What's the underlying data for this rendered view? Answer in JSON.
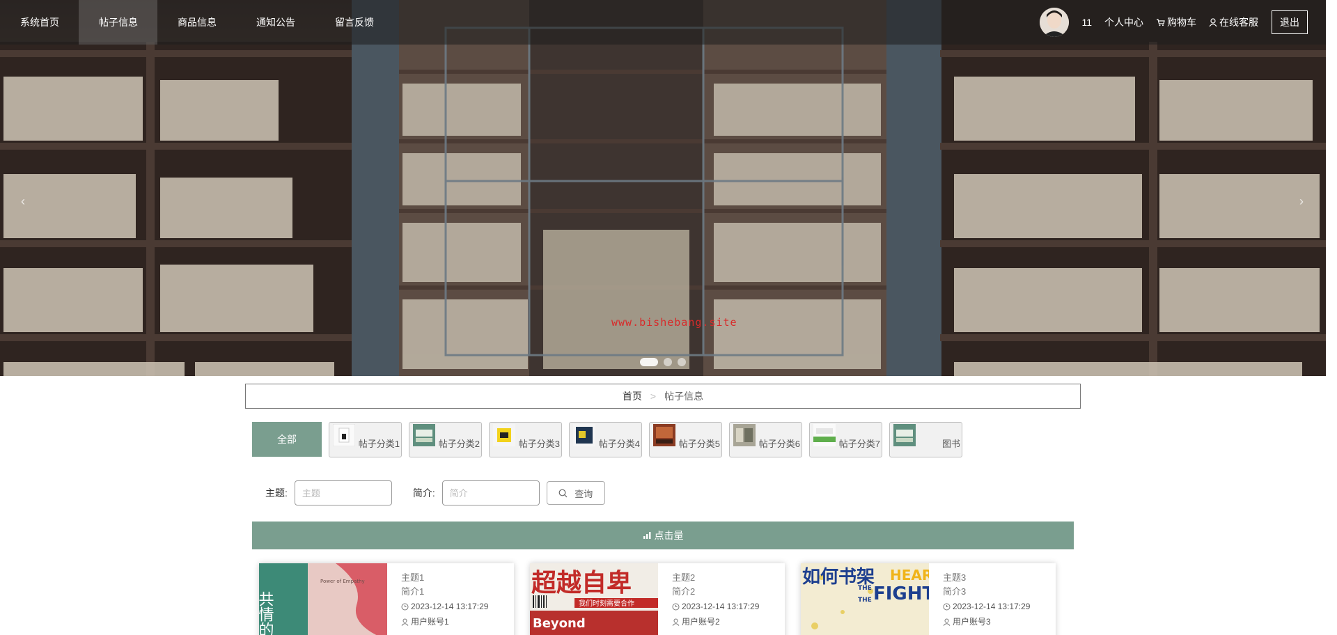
{
  "nav": {
    "items": [
      {
        "label": "系统首页"
      },
      {
        "label": "帖子信息"
      },
      {
        "label": "商品信息"
      },
      {
        "label": "通知公告"
      },
      {
        "label": "留言反馈"
      }
    ],
    "active_index": 1,
    "username": "11",
    "profile_label": "个人中心",
    "cart_label": "购物车",
    "service_label": "在线客服",
    "logout_label": "退出"
  },
  "carousel": {
    "watermark": "www.bishebang.site",
    "slide_count": 3,
    "active_slide": 0
  },
  "breadcrumb": {
    "home": "首页",
    "separator": ">",
    "current": "帖子信息"
  },
  "categories": {
    "all_label": "全部",
    "items": [
      {
        "label": "帖子分类1"
      },
      {
        "label": "帖子分类2"
      },
      {
        "label": "帖子分类3"
      },
      {
        "label": "帖子分类4"
      },
      {
        "label": "帖子分类5"
      },
      {
        "label": "帖子分类6"
      },
      {
        "label": "帖子分类7"
      },
      {
        "label": "图书"
      }
    ]
  },
  "search": {
    "subject_label": "主题:",
    "subject_placeholder": "主题",
    "subject_value": "",
    "intro_label": "简介:",
    "intro_placeholder": "简介",
    "intro_value": "",
    "query_label": "查询"
  },
  "sort_bar": {
    "label": "点击量"
  },
  "posts": [
    {
      "title": "主题1",
      "intro": "简介1",
      "time": "2023-12-14 13:17:29",
      "account": "用户账号1"
    },
    {
      "title": "主题2",
      "intro": "简介2",
      "time": "2023-12-14 13:17:29",
      "account": "用户账号2"
    },
    {
      "title": "主题3",
      "intro": "简介3",
      "time": "2023-12-14 13:17:29",
      "account": "用户账号3"
    }
  ],
  "covers": {
    "cover1": {
      "big": "共情的力",
      "small": "Power of Empathy"
    },
    "cover2": {
      "big": "超越自卑",
      "small": "我们时刻需要合作",
      "tag": "Beyond"
    },
    "cover3": {
      "big": "如何书架",
      "small_top": "THE",
      "small_mid": "THE",
      "big_en": "FIGHT",
      "top_en": "HEAR"
    }
  },
  "colors": {
    "accent": "#7a9e8f",
    "nav_bg": "#1e1e1e",
    "watermark": "#d82a2a"
  }
}
